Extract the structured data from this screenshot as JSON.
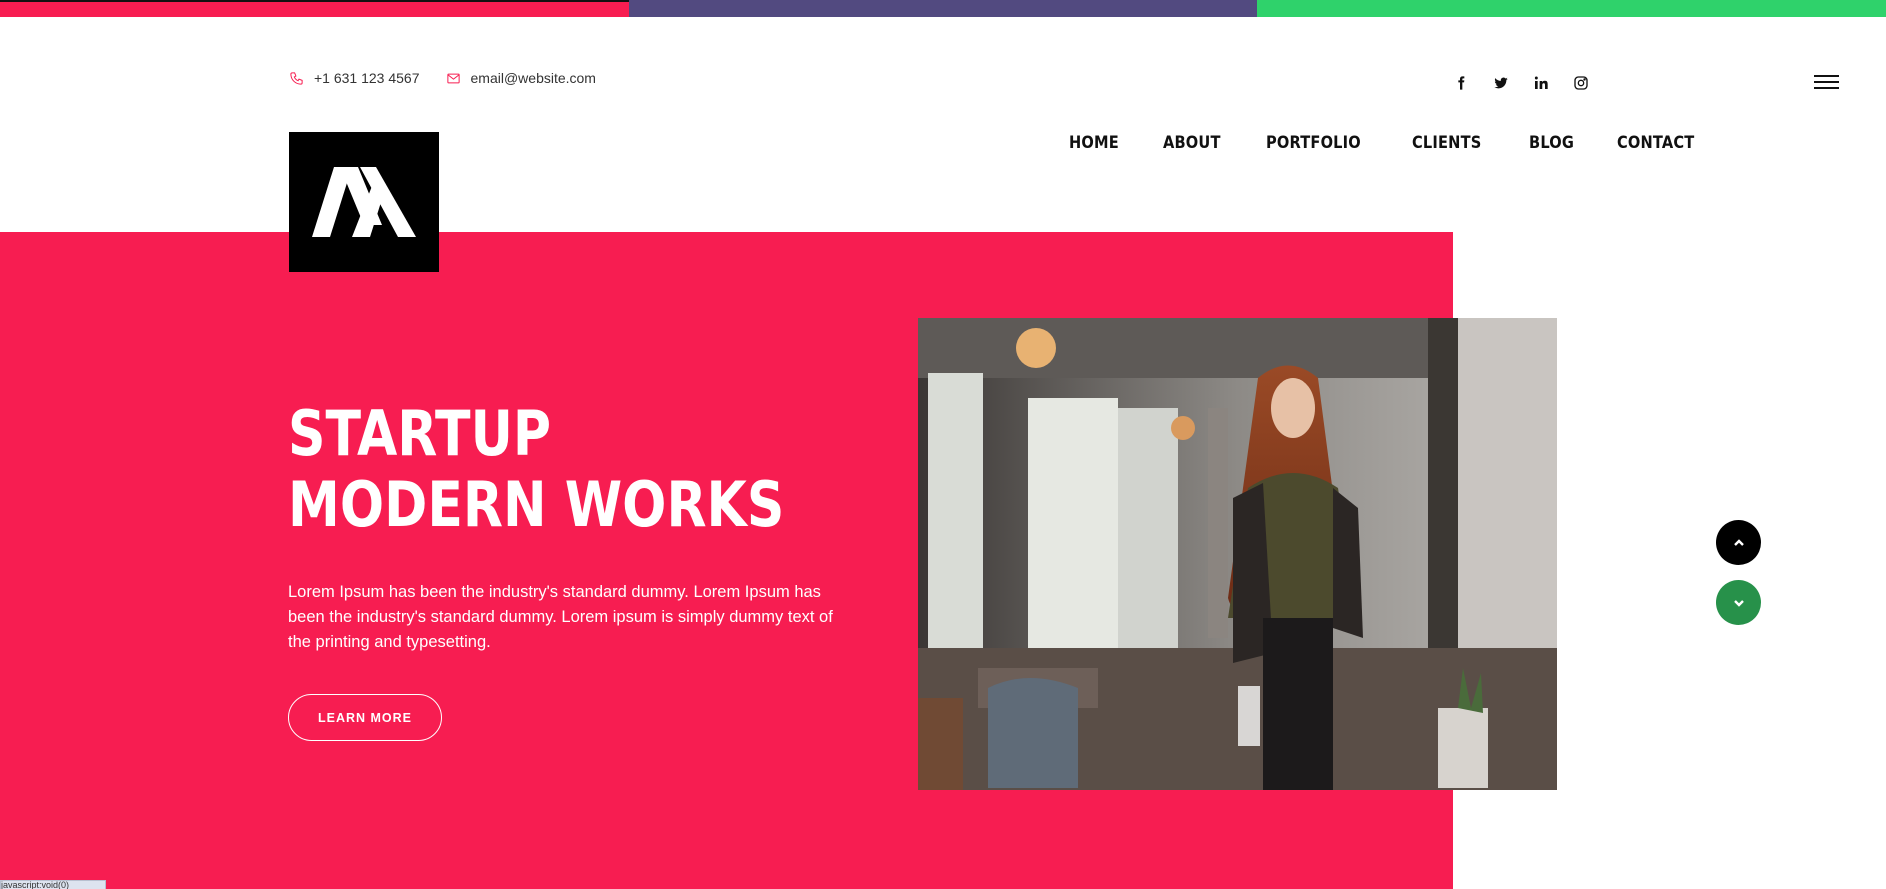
{
  "colors": {
    "brand_red": "#f71d51",
    "bar_purple": "#524a80",
    "bar_green": "#2fd26b",
    "scroll_up_bg": "#000000",
    "scroll_down_bg": "#27914a",
    "logo_bg": "#000000"
  },
  "topbar": {
    "segments": [
      "brand_red",
      "bar_purple",
      "bar_green"
    ]
  },
  "contact": {
    "phone_icon": "phone-icon",
    "phone": "+1 631 123 4567",
    "email_icon": "mail-icon",
    "email": "email@website.com"
  },
  "social": [
    "facebook-icon",
    "twitter-icon",
    "linkedin-icon",
    "instagram-icon"
  ],
  "nav": {
    "items": [
      "HOME",
      "ABOUT",
      "PORTFOLIO",
      "CLIENTS",
      "BLOG",
      "CONTACT"
    ]
  },
  "hero": {
    "title_line1": "STARTUP",
    "title_line2": "MODERN WORKS",
    "text": "Lorem Ipsum has been the industry's standard dummy. Lorem Ipsum has been the industry's standard dummy. Lorem ipsum is simply dummy text of the printing and typesetting.",
    "button": "LEARN MORE"
  },
  "scroll": {
    "up_icon": "chevron-up-icon",
    "down_icon": "chevron-down-icon"
  },
  "status_bar": "javascript:void(0)"
}
